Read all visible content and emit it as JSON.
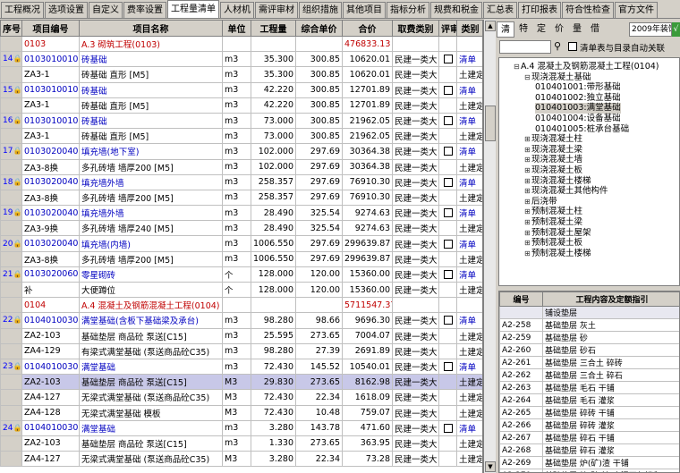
{
  "tabs": [
    "工程概况",
    "选项设置",
    "自定义",
    "费率设置",
    "工程量清单",
    "人材机",
    "需评审材",
    "组织措施",
    "其他项目",
    "指标分析",
    "规费和税金",
    "汇总表",
    "打印报表",
    "符合性检查",
    "官方文件"
  ],
  "active_tab": "工程量清单",
  "table": {
    "headers": [
      "序号",
      "项目编号",
      "项目名称",
      "单位",
      "工程量",
      "综合单价",
      "合价",
      "取费类别",
      "评审",
      "类别"
    ],
    "rows": [
      {
        "kind": "sec",
        "sn": "",
        "code": "0103",
        "name": "A.3 砌筑工程(0103)",
        "unit": "",
        "qty": "",
        "price": "",
        "total": "476833.13",
        "fee": "",
        "chk": false,
        "type": ""
      },
      {
        "kind": "item",
        "sn": "14",
        "code": "010301001001",
        "name": "砖基础",
        "unit": "m3",
        "qty": "35.300",
        "price": "300.85",
        "total": "10620.01",
        "fee": "民建一类大",
        "chk": true,
        "type": "清单"
      },
      {
        "kind": "quota",
        "sn": "",
        "code": "ZA3-1",
        "name": "砖基础 直形 [M5]",
        "unit": "m3",
        "qty": "35.300",
        "price": "300.85",
        "total": "10620.01",
        "fee": "民建一类大",
        "chk": false,
        "type": "土建定额"
      },
      {
        "kind": "item",
        "sn": "15",
        "code": "010301001002",
        "name": "砖基础",
        "unit": "m3",
        "qty": "42.220",
        "price": "300.85",
        "total": "12701.89",
        "fee": "民建一类大",
        "chk": true,
        "type": "清单"
      },
      {
        "kind": "quota",
        "sn": "",
        "code": "ZA3-1",
        "name": "砖基础 直形 [M5]",
        "unit": "m3",
        "qty": "42.220",
        "price": "300.85",
        "total": "12701.89",
        "fee": "民建一类大",
        "chk": false,
        "type": "土建定额"
      },
      {
        "kind": "item",
        "sn": "16",
        "code": "010301001003",
        "name": "砖基础",
        "unit": "m3",
        "qty": "73.000",
        "price": "300.85",
        "total": "21962.05",
        "fee": "民建一类大",
        "chk": true,
        "type": "清单"
      },
      {
        "kind": "quota",
        "sn": "",
        "code": "ZA3-1",
        "name": "砖基础 直形 [M5]",
        "unit": "m3",
        "qty": "73.000",
        "price": "300.85",
        "total": "21962.05",
        "fee": "民建一类大",
        "chk": false,
        "type": "土建定额"
      },
      {
        "kind": "item",
        "sn": "17",
        "code": "010302004001",
        "name": "填充墙(地下室)",
        "unit": "m3",
        "qty": "102.000",
        "price": "297.69",
        "total": "30364.38",
        "fee": "民建一类大",
        "chk": true,
        "type": "清单"
      },
      {
        "kind": "quota",
        "sn": "",
        "code": "ZA3-8换",
        "name": "多孔砖墙 墙厚200 [M5]",
        "unit": "m3",
        "qty": "102.000",
        "price": "297.69",
        "total": "30364.38",
        "fee": "民建一类大",
        "chk": false,
        "type": "土建定额"
      },
      {
        "kind": "item",
        "sn": "18",
        "code": "010302004002",
        "name": "填充墙外墙",
        "unit": "m3",
        "qty": "258.357",
        "price": "297.69",
        "total": "76910.30",
        "fee": "民建一类大",
        "chk": true,
        "type": "清单"
      },
      {
        "kind": "quota",
        "sn": "",
        "code": "ZA3-8换",
        "name": "多孔砖墙 墙厚200 [M5]",
        "unit": "m3",
        "qty": "258.357",
        "price": "297.69",
        "total": "76910.30",
        "fee": "民建一类大",
        "chk": false,
        "type": "土建定额"
      },
      {
        "kind": "item",
        "sn": "19",
        "code": "010302004003",
        "name": "填充墙外墙",
        "unit": "m3",
        "qty": "28.490",
        "price": "325.54",
        "total": "9274.63",
        "fee": "民建一类大",
        "chk": true,
        "type": "清单"
      },
      {
        "kind": "quota",
        "sn": "",
        "code": "ZA3-9换",
        "name": "多孔砖墙 墙厚240 [M5]",
        "unit": "m3",
        "qty": "28.490",
        "price": "325.54",
        "total": "9274.63",
        "fee": "民建一类大",
        "chk": false,
        "type": "土建定额"
      },
      {
        "kind": "item",
        "sn": "20",
        "code": "010302004004",
        "name": "填充墙(内墙)",
        "unit": "m3",
        "qty": "1006.550",
        "price": "297.69",
        "total": "299639.87",
        "fee": "民建一类大",
        "chk": true,
        "type": "清单"
      },
      {
        "kind": "quota",
        "sn": "",
        "code": "ZA3-8换",
        "name": "多孔砖墙 墙厚200 [M5]",
        "unit": "m3",
        "qty": "1006.550",
        "price": "297.69",
        "total": "299639.87",
        "fee": "民建一类大",
        "chk": false,
        "type": "土建定额"
      },
      {
        "kind": "item",
        "sn": "21",
        "code": "010302006001",
        "name": "零星砌砖",
        "unit": "个",
        "qty": "128.000",
        "price": "120.00",
        "total": "15360.00",
        "fee": "民建一类大",
        "chk": true,
        "type": "清单"
      },
      {
        "kind": "quota",
        "sn": "",
        "code": "补",
        "name": "大便蹲位",
        "unit": "个",
        "qty": "128.000",
        "price": "120.00",
        "total": "15360.00",
        "fee": "民建一类大",
        "chk": false,
        "type": "土建定额"
      },
      {
        "kind": "sec",
        "sn": "",
        "code": "0104",
        "name": "A.4 混凝土及钢筋混凝土工程(0104)",
        "unit": "",
        "qty": "",
        "price": "",
        "total": "5711547.37",
        "fee": "",
        "chk": false,
        "type": ""
      },
      {
        "kind": "item",
        "sn": "22",
        "code": "010401003001",
        "name": "满堂基础(含板下基础梁及承台)",
        "unit": "m3",
        "qty": "98.280",
        "price": "98.66",
        "total": "9696.30",
        "fee": "民建一类大",
        "chk": true,
        "type": "清单"
      },
      {
        "kind": "quota",
        "sn": "",
        "code": "ZA2-103",
        "name": "基础垫层 商品砼 泵送[C15]",
        "unit": "m3",
        "qty": "25.595",
        "price": "273.65",
        "total": "7004.07",
        "fee": "民建一类大",
        "chk": false,
        "type": "土建定额"
      },
      {
        "kind": "quota",
        "sn": "",
        "code": "ZA4-129",
        "name": "有梁式满堂基础 (泵送商品砼C35)",
        "unit": "m3",
        "qty": "98.280",
        "price": "27.39",
        "total": "2691.89",
        "fee": "民建一类大",
        "chk": false,
        "type": "土建定额"
      },
      {
        "kind": "item",
        "sn": "23",
        "code": "010401003002",
        "name": "满堂基础",
        "unit": "m3",
        "qty": "72.430",
        "price": "145.52",
        "total": "10540.01",
        "fee": "民建一类大",
        "chk": true,
        "type": "清单"
      },
      {
        "kind": "sel",
        "sn": "",
        "code": "ZA2-103",
        "name": "基础垫层 商品砼 泵送[C15]",
        "unit": "M3",
        "qty": "29.830",
        "price": "273.65",
        "total": "8162.98",
        "fee": "民建一类大",
        "chk": false,
        "type": "土建定额"
      },
      {
        "kind": "quota",
        "sn": "",
        "code": "ZA4-127",
        "name": "无梁式满堂基础 (泵送商品砼C35)",
        "unit": "M3",
        "qty": "72.430",
        "price": "22.34",
        "total": "1618.09",
        "fee": "民建一类大",
        "chk": false,
        "type": "土建定额"
      },
      {
        "kind": "quota",
        "sn": "",
        "code": "ZA4-128",
        "name": "无梁式满堂基础 模板",
        "unit": "M3",
        "qty": "72.430",
        "price": "10.48",
        "total": "759.07",
        "fee": "民建一类大",
        "chk": false,
        "type": "土建定额"
      },
      {
        "kind": "item",
        "sn": "24",
        "code": "010401003003",
        "name": "满堂基础",
        "unit": "m3",
        "qty": "3.280",
        "price": "143.78",
        "total": "471.60",
        "fee": "民建一类大",
        "chk": true,
        "type": "清单"
      },
      {
        "kind": "quota",
        "sn": "",
        "code": "ZA2-103",
        "name": "基础垫层 商品砼 泵送[C15]",
        "unit": "m3",
        "qty": "1.330",
        "price": "273.65",
        "total": "363.95",
        "fee": "民建一类大",
        "chk": false,
        "type": "土建定额"
      },
      {
        "kind": "quota",
        "sn": "",
        "code": "ZA4-127",
        "name": "无梁式满堂基础 (泵送商品砼C35)",
        "unit": "M3",
        "qty": "3.280",
        "price": "22.34",
        "total": "73.28",
        "fee": "民建一类大",
        "chk": false,
        "type": "土建定额"
      }
    ]
  },
  "right_tabs": [
    "清",
    "特",
    "定",
    "价",
    "量",
    "借"
  ],
  "right_active_tab": "清",
  "year_select": "2009年装饰",
  "link_checkbox_label": "清单表与目录自动关联",
  "tree": [
    {
      "t": "A.4 混凝土及钢筋混凝土工程(0104)",
      "lvl": 0,
      "x": "⊟",
      "sel": false
    },
    {
      "t": "现浇混凝土基础",
      "lvl": 1,
      "x": "⊟",
      "sel": false
    },
    {
      "t": "010401001:带形基础",
      "lvl": 2,
      "x": "",
      "sel": false
    },
    {
      "t": "010401002:独立基础",
      "lvl": 2,
      "x": "",
      "sel": false
    },
    {
      "t": "010401003:满堂基础",
      "lvl": 2,
      "x": "",
      "sel": true
    },
    {
      "t": "010401004:设备基础",
      "lvl": 2,
      "x": "",
      "sel": false
    },
    {
      "t": "010401005:桩承台基础",
      "lvl": 2,
      "x": "",
      "sel": false
    },
    {
      "t": "现浇混凝土柱",
      "lvl": 1,
      "x": "⊞",
      "sel": false
    },
    {
      "t": "现浇混凝土梁",
      "lvl": 1,
      "x": "⊞",
      "sel": false
    },
    {
      "t": "现浇混凝土墙",
      "lvl": 1,
      "x": "⊞",
      "sel": false
    },
    {
      "t": "现浇混凝土板",
      "lvl": 1,
      "x": "⊞",
      "sel": false
    },
    {
      "t": "现浇混凝土楼梯",
      "lvl": 1,
      "x": "⊞",
      "sel": false
    },
    {
      "t": "现浇混凝土其他构件",
      "lvl": 1,
      "x": "⊞",
      "sel": false
    },
    {
      "t": "后浇带",
      "lvl": 1,
      "x": "⊞",
      "sel": false
    },
    {
      "t": "预制混凝土柱",
      "lvl": 1,
      "x": "⊞",
      "sel": false
    },
    {
      "t": "预制混凝土梁",
      "lvl": 1,
      "x": "⊞",
      "sel": false
    },
    {
      "t": "预制混凝土屋架",
      "lvl": 1,
      "x": "⊞",
      "sel": false
    },
    {
      "t": "预制混凝土板",
      "lvl": 1,
      "x": "⊞",
      "sel": false
    },
    {
      "t": "预制混凝土楼梯",
      "lvl": 1,
      "x": "⊞",
      "sel": false
    }
  ],
  "quota_table": {
    "headers": [
      "编号",
      "工程内容及定额指引"
    ],
    "subheader": "铺设垫层",
    "rows": [
      [
        "A2-258",
        "基础垫层 灰土"
      ],
      [
        "A2-259",
        "基础垫层 砂"
      ],
      [
        "A2-260",
        "基础垫层 砂石"
      ],
      [
        "A2-261",
        "基础垫层 三合土 碎砖"
      ],
      [
        "A2-262",
        "基础垫层 三合土 碎石"
      ],
      [
        "A2-263",
        "基础垫层 毛石 干铺"
      ],
      [
        "A2-264",
        "基础垫层 毛石 灌浆"
      ],
      [
        "A2-265",
        "基础垫层 碎砖 干铺"
      ],
      [
        "A2-266",
        "基础垫层 碎砖 灌浆"
      ],
      [
        "A2-267",
        "基础垫层 碎石 干铺"
      ],
      [
        "A2-268",
        "基础垫层 碎石 灌浆"
      ],
      [
        "A2-269",
        "基础垫层 炉(矿)渣 干铺"
      ],
      [
        "A2-270",
        "基础垫层 炉(矿)渣 水泥石灰拌和"
      ],
      [
        "A2-271",
        "基础垫层 炉(矿)渣 石灰拌和"
      ]
    ]
  }
}
